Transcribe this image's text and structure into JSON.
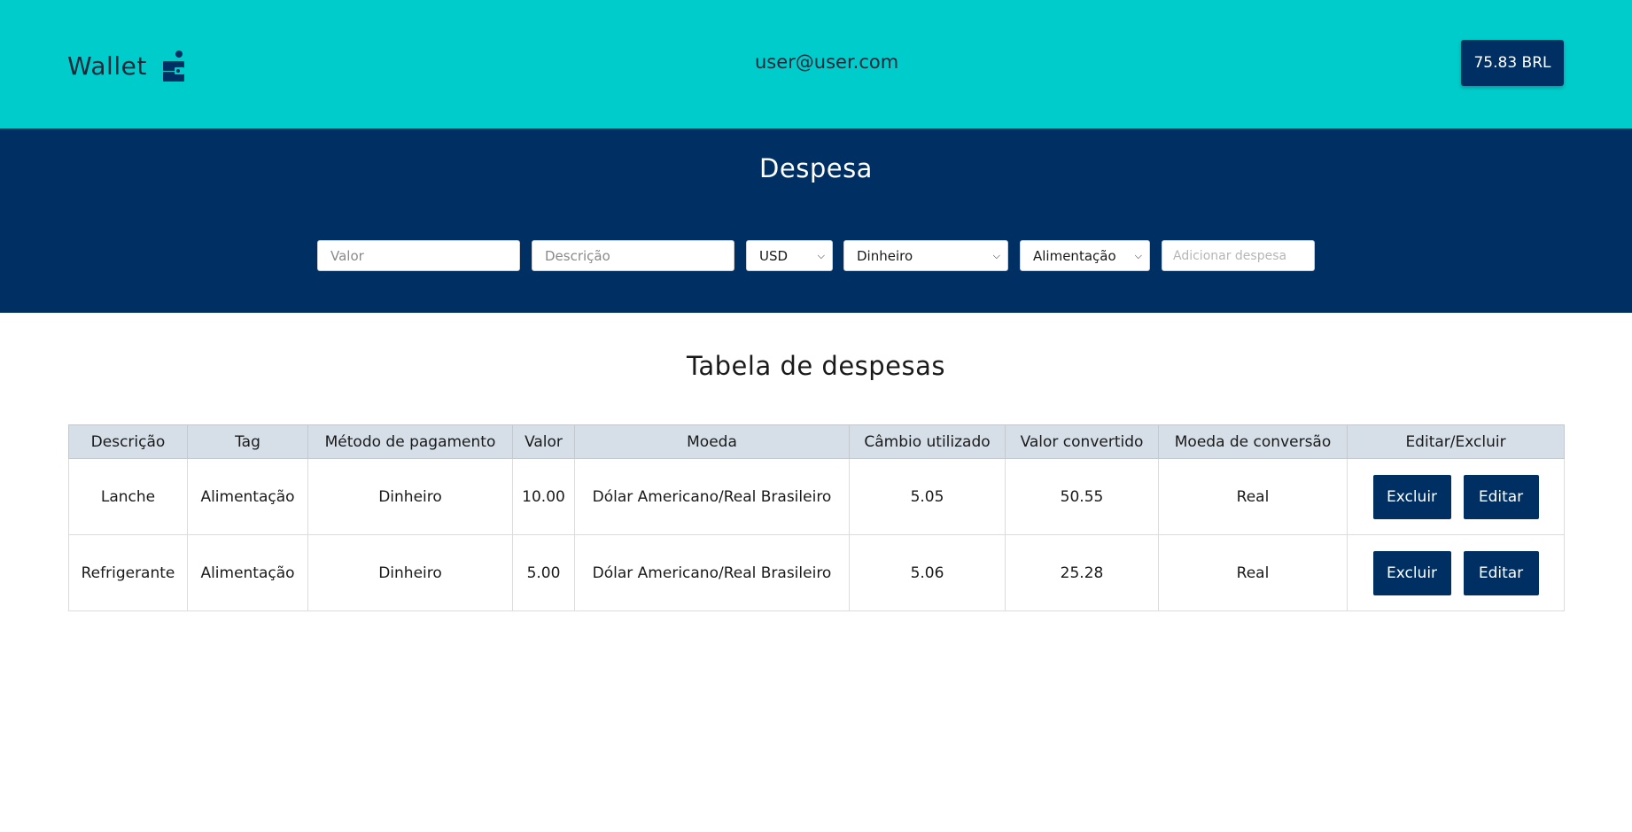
{
  "header": {
    "logo_text": "Wallet",
    "logo_icon": "wallet-icon",
    "user_email": "user@user.com",
    "balance": "75.83 BRL"
  },
  "form": {
    "title": "Despesa",
    "value_placeholder": "Valor",
    "description_placeholder": "Descrição",
    "currency_selected": "USD",
    "method_selected": "Dinheiro",
    "tag_selected": "Alimentação",
    "add_button_label": "Adicionar despesa"
  },
  "table": {
    "title": "Tabela de despesas",
    "headers": [
      "Descrição",
      "Tag",
      "Método de pagamento",
      "Valor",
      "Moeda",
      "Câmbio utilizado",
      "Valor convertido",
      "Moeda de conversão",
      "Editar/Excluir"
    ],
    "rows": [
      {
        "description": "Lanche",
        "tag": "Alimentação",
        "method": "Dinheiro",
        "value": "10.00",
        "currency": "Dólar Americano/Real Brasileiro",
        "rate": "5.05",
        "converted": "50.55",
        "conversion_currency": "Real",
        "delete_label": "Excluir",
        "edit_label": "Editar"
      },
      {
        "description": "Refrigerante",
        "tag": "Alimentação",
        "method": "Dinheiro",
        "value": "5.00",
        "currency": "Dólar Americano/Real Brasileiro",
        "rate": "5.06",
        "converted": "25.28",
        "conversion_currency": "Real",
        "delete_label": "Excluir",
        "edit_label": "Editar"
      }
    ]
  },
  "colors": {
    "header_bg": "#00cccc",
    "form_bg": "#003063",
    "button_bg": "#003063",
    "table_header_bg": "#d6dfe8"
  }
}
